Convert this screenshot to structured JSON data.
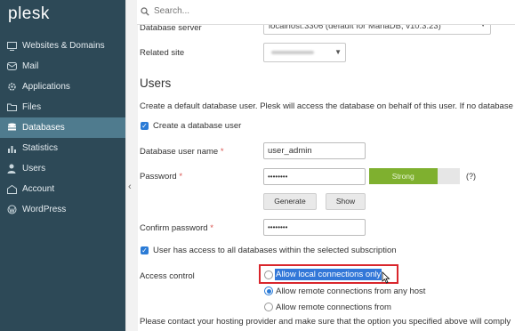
{
  "brand": {
    "logo": "plesk"
  },
  "search": {
    "placeholder": "Search..."
  },
  "sidebar": {
    "items": [
      {
        "label": "Websites & Domains",
        "icon": "monitor-icon",
        "active": false
      },
      {
        "label": "Mail",
        "icon": "mail-icon",
        "active": false
      },
      {
        "label": "Applications",
        "icon": "gear-icon",
        "active": false
      },
      {
        "label": "Files",
        "icon": "folder-icon",
        "active": false
      },
      {
        "label": "Databases",
        "icon": "database-icon",
        "active": true
      },
      {
        "label": "Statistics",
        "icon": "bar-chart-icon",
        "active": false
      },
      {
        "label": "Users",
        "icon": "user-icon",
        "active": false
      },
      {
        "label": "Account",
        "icon": "account-icon",
        "active": false
      },
      {
        "label": "WordPress",
        "icon": "wordpress-icon",
        "active": false
      }
    ]
  },
  "form": {
    "db_server": {
      "label": "Database server",
      "value": "localhost:3306 (default for MariaDB, v10.3.23)"
    },
    "related_site": {
      "label": "Related site"
    },
    "users_heading": "Users",
    "users_desc": "Create a default database user. Plesk will access the database on behalf of this user. If no database u",
    "create_user_label": "Create a database user",
    "username": {
      "label": "Database user name",
      "required": "*",
      "value": "user_admin"
    },
    "password": {
      "label": "Password",
      "required": "*",
      "value": "••••••••",
      "strength": "Strong",
      "strength_fill": 0.75,
      "help": "(?)"
    },
    "generate_label": "Generate",
    "show_label": "Show",
    "confirm": {
      "label": "Confirm password",
      "required": "*",
      "value": "••••••••"
    },
    "all_db_access_label": "User has access to all databases within the selected subscription",
    "access_control": {
      "label": "Access control",
      "options": [
        {
          "label": "Allow local connections only",
          "selected": false,
          "highlighted": true
        },
        {
          "label": "Allow remote connections from any host",
          "selected": true
        },
        {
          "label": "Allow remote connections from",
          "selected": false
        }
      ]
    },
    "footer_note": "Please contact your hosting provider and make sure that the option you specified above will comply"
  },
  "colors": {
    "sidebar": "#2d4957",
    "active": "#4f7b8e",
    "strength": "#7fb02f",
    "highlight_box": "#d9262c",
    "selection": "#3277d8",
    "link": "#2b7bd6"
  }
}
